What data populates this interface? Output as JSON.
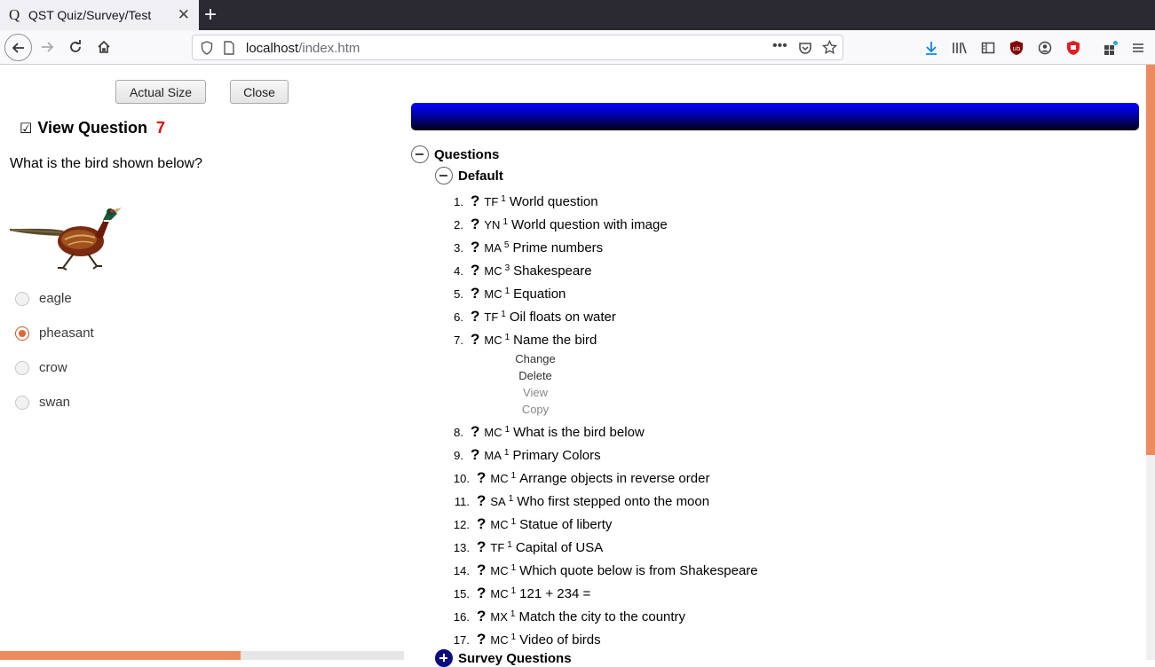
{
  "browser": {
    "tab_title": "QST Quiz/Survey/Test",
    "tab_favicon": "Q",
    "url_host": "localhost",
    "url_path": "/index.htm"
  },
  "left": {
    "actual_size_label": "Actual Size",
    "close_label": "Close",
    "view_question_label": "View Question",
    "question_number": "7",
    "question_text": "What is the bird shown below?",
    "options": [
      {
        "label": "eagle",
        "selected": false
      },
      {
        "label": "pheasant",
        "selected": true
      },
      {
        "label": "crow",
        "selected": false
      },
      {
        "label": "swan",
        "selected": false
      }
    ],
    "progress_fraction": 0.595
  },
  "tree": {
    "root_label": "Questions",
    "group_label": "Default",
    "survey_label": "Survey Questions",
    "questions": [
      {
        "n": "1.",
        "type": "TF",
        "count": "1",
        "text": "World question"
      },
      {
        "n": "2.",
        "type": "YN",
        "count": "1",
        "text": "World question with image"
      },
      {
        "n": "3.",
        "type": "MA",
        "count": "5",
        "text": "Prime numbers"
      },
      {
        "n": "4.",
        "type": "MC",
        "count": "3",
        "text": "Shakespeare"
      },
      {
        "n": "5.",
        "type": "MC",
        "count": "1",
        "text": "Equation"
      },
      {
        "n": "6.",
        "type": "TF",
        "count": "1",
        "text": "Oil floats on water"
      },
      {
        "n": "7.",
        "type": "MC",
        "count": "1",
        "text": "Name the bird"
      },
      {
        "n": "8.",
        "type": "MC",
        "count": "1",
        "text": "What is the bird below"
      },
      {
        "n": "9.",
        "type": "MA",
        "count": "1",
        "text": "Primary Colors"
      },
      {
        "n": "10.",
        "type": "MC",
        "count": "1",
        "text": "Arrange objects in reverse order"
      },
      {
        "n": "11.",
        "type": "SA",
        "count": "1",
        "text": "Who first stepped onto the moon"
      },
      {
        "n": "12.",
        "type": "MC",
        "count": "1",
        "text": "Statue of liberty"
      },
      {
        "n": "13.",
        "type": "TF",
        "count": "1",
        "text": "Capital of USA"
      },
      {
        "n": "14.",
        "type": "MC",
        "count": "1",
        "text": "Which quote below is from Shakespeare"
      },
      {
        "n": "15.",
        "type": "MC",
        "count": "1",
        "text": "121 + 234 ="
      },
      {
        "n": "16.",
        "type": "MX",
        "count": "1",
        "text": "Match the city to the country"
      },
      {
        "n": "17.",
        "type": "MC",
        "count": "1",
        "text": "Video of birds"
      }
    ],
    "context_menu": [
      {
        "label": "Change",
        "color": "#333333"
      },
      {
        "label": "Delete",
        "color": "#333333"
      },
      {
        "label": "View",
        "color": "#888888"
      },
      {
        "label": "Copy",
        "color": "#888888"
      }
    ]
  },
  "colors": {
    "accent": "#ec8b5e",
    "question_number": "#e00000",
    "banner": "#0000ff"
  }
}
